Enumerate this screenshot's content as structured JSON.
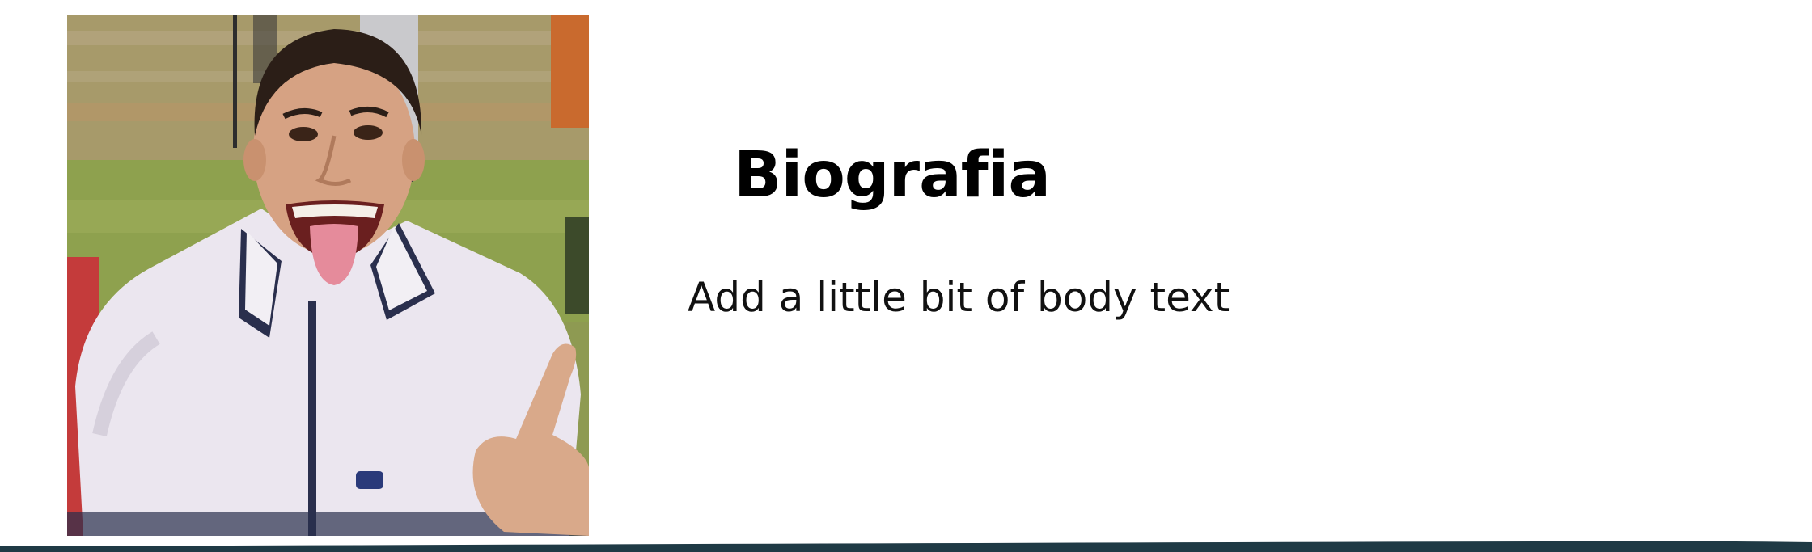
{
  "slide": {
    "title": "Biografia",
    "body": "Add a little bit of body text"
  },
  "photo": {
    "subject": "smiling-young-man-portrait"
  },
  "colors": {
    "background": "#ffffff",
    "text": "#000000",
    "footer_band": "#1f3a45"
  }
}
